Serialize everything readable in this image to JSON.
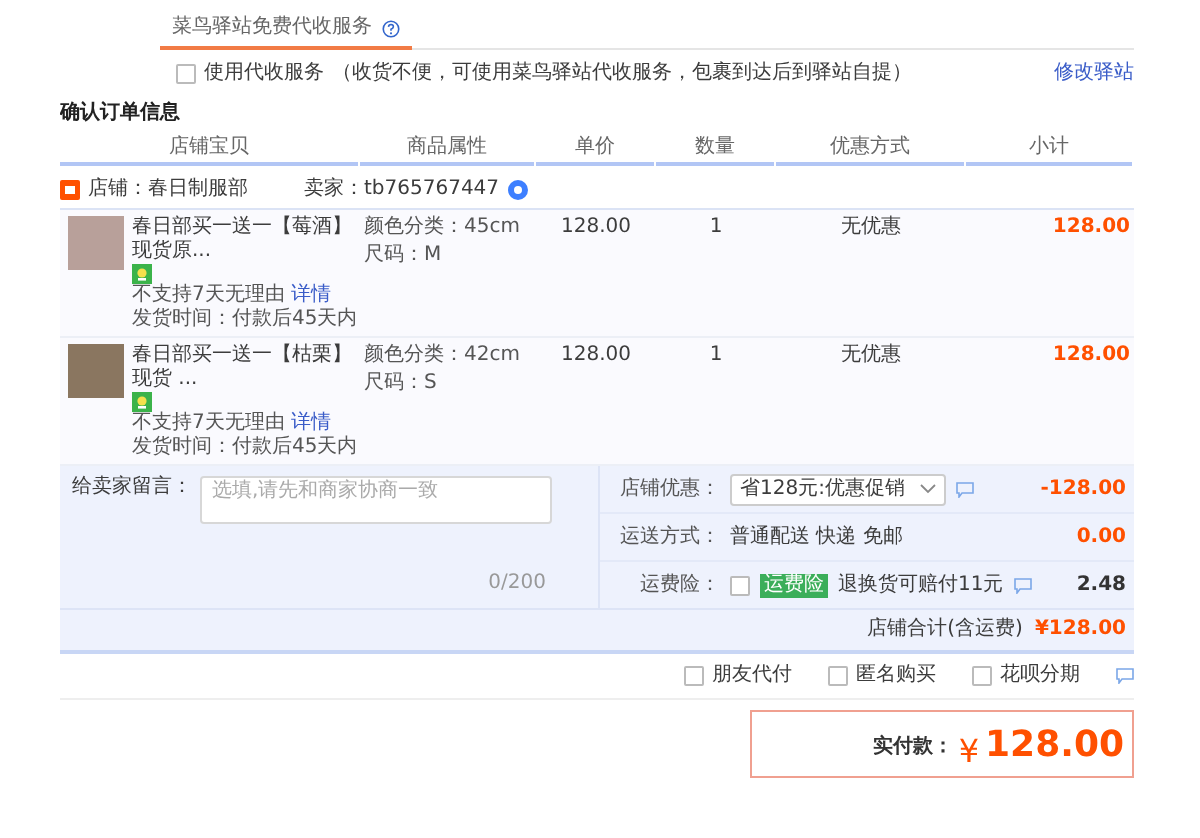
{
  "service_tab": {
    "label": "菜鸟驿站免费代收服务"
  },
  "delivery_service": {
    "checked": false,
    "label": "使用代收服务",
    "note": "（收货不便，可使用菜鸟驿站代收服务，包裹到达后到驿站自提）",
    "link": "修改驿站"
  },
  "section_title": "确认订单信息",
  "columns": [
    "店铺宝贝",
    "商品属性",
    "单价",
    "数量",
    "优惠方式",
    "小计"
  ],
  "shop": {
    "label": "店铺：春日制服部",
    "seller": "卖家：tb765767447"
  },
  "items": [
    {
      "title": "春日部买一送一【莓酒】现货原...",
      "color_attr": "颜色分类：45cm",
      "size": "尺码：M",
      "return_note": "不支持7天无理由",
      "detail_link": "详情",
      "ship_time": "发货时间：付款后45天内",
      "price": "128.00",
      "qty": "1",
      "discount": "无优惠",
      "subtotal": "128.00"
    },
    {
      "title": "春日部买一送一【枯栗】现货 ...",
      "color_attr": "颜色分类：42cm",
      "size": "尺码：S",
      "return_note": "不支持7天无理由",
      "detail_link": "详情",
      "ship_time": "发货时间：付款后45天内",
      "price": "128.00",
      "qty": "1",
      "discount": "无优惠",
      "subtotal": "128.00"
    }
  ],
  "message": {
    "label": "给卖家留言：",
    "placeholder": "选填,请先和商家协商一致",
    "counter": "0/200"
  },
  "shop_discount": {
    "label": "店铺优惠：",
    "value": "省128元:优惠促销",
    "amount": "-128.00"
  },
  "shipping": {
    "label": "运送方式：",
    "value": "普通配送 快递 免邮",
    "amount": "0.00"
  },
  "insurance": {
    "label": "运费险：",
    "checked": false,
    "badge": "运费险",
    "text": "退换货可赔付11元",
    "amount": "2.48"
  },
  "shop_total": {
    "label": "店铺合计(含运费)",
    "amount": "¥128.00"
  },
  "options": [
    {
      "label": "朋友代付",
      "checked": false
    },
    {
      "label": "匿名购买",
      "checked": false
    },
    {
      "label": "花呗分期",
      "checked": false
    }
  ],
  "payment": {
    "label": "实付款：",
    "currency": "¥",
    "amount": "128.00"
  }
}
